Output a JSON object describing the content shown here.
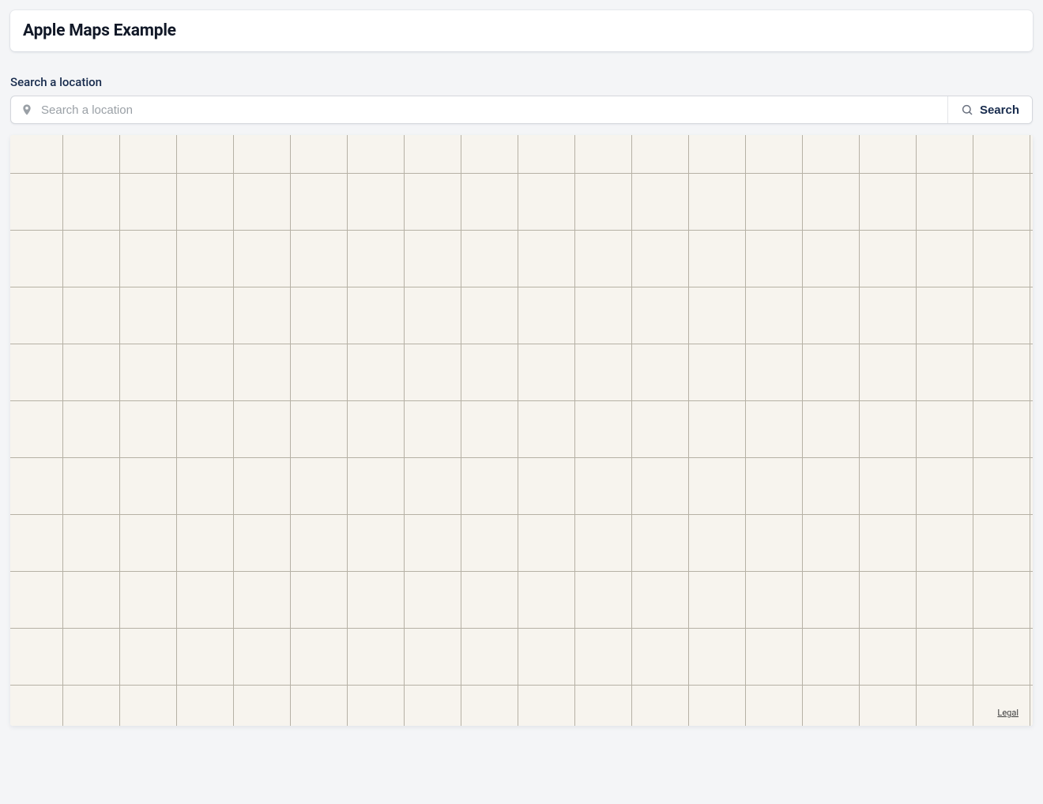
{
  "header": {
    "title": "Apple Maps Example"
  },
  "search": {
    "label": "Search a location",
    "placeholder": "Search a location",
    "value": "",
    "button_label": "Search"
  },
  "map": {
    "legal_label": "Legal"
  }
}
